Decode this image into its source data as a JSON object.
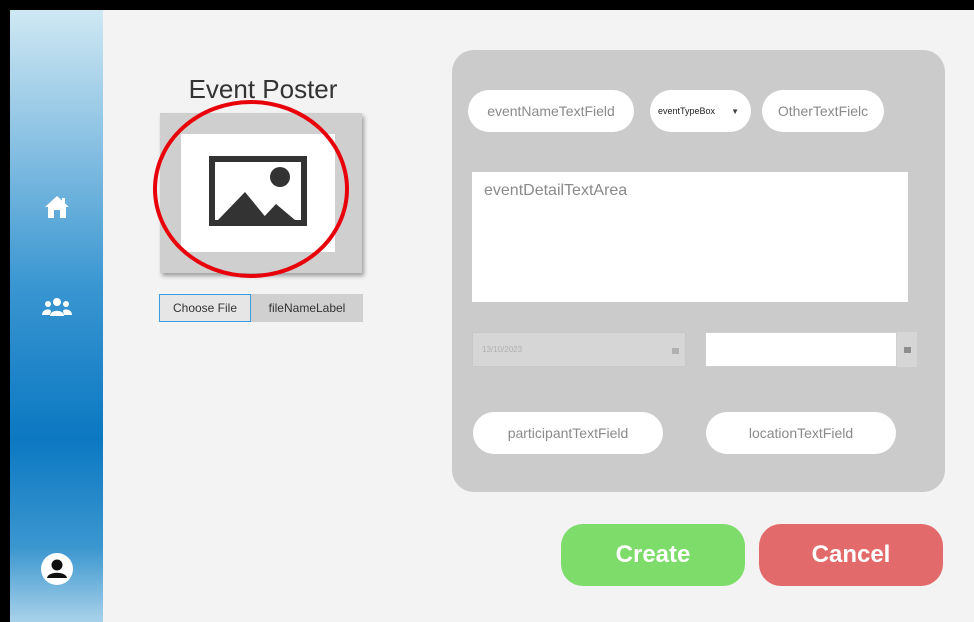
{
  "sidebar": {
    "icons": [
      "home-icon",
      "users-icon",
      "account-icon"
    ]
  },
  "poster": {
    "title": "Event Poster",
    "image_icon": "image-placeholder-icon",
    "choose_file_label": "Choose File",
    "file_name_label": "fileNameLabel"
  },
  "form": {
    "event_name_placeholder": "eventNameTextField",
    "event_type_value": "eventTypeBox",
    "other_placeholder": "OtherTextFielc",
    "event_detail_placeholder": "eventDetailTextArea",
    "start_date_value": "13/10/2023",
    "end_date_value": "",
    "participant_placeholder": "participantTextField",
    "location_placeholder": "locationTextField"
  },
  "actions": {
    "create_label": "Create",
    "cancel_label": "Cancel"
  },
  "colors": {
    "create": "#7ddc6a",
    "cancel": "#e36a6a",
    "highlight": "#e8000a"
  }
}
